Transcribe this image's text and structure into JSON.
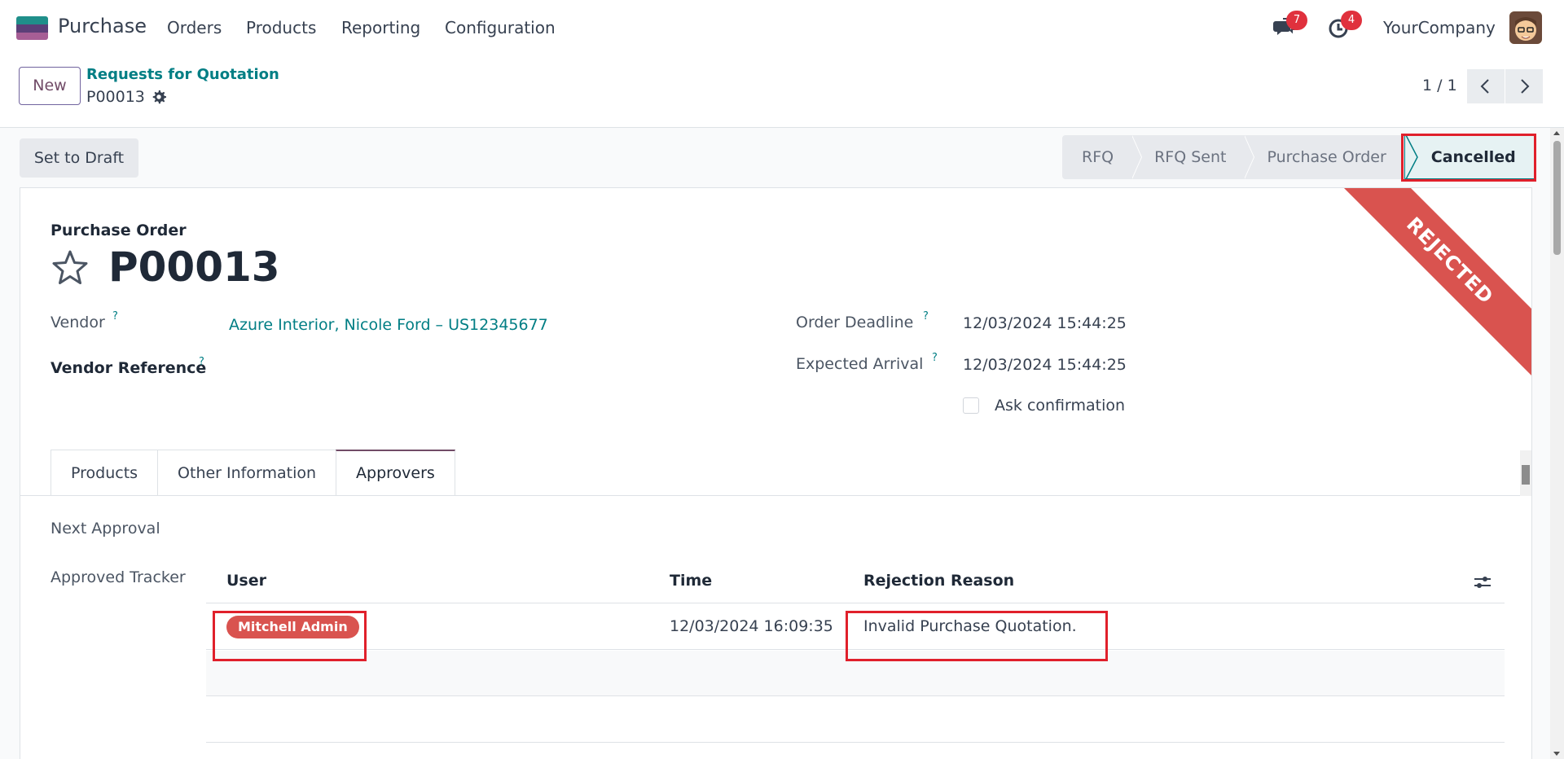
{
  "navbar": {
    "app_name": "Purchase",
    "menu": [
      "Orders",
      "Products",
      "Reporting",
      "Configuration"
    ],
    "messages_count": "7",
    "activities_count": "4",
    "company": "YourCompany"
  },
  "control": {
    "new_label": "New",
    "breadcrumb_parent": "Requests for Quotation",
    "breadcrumb_current": "P00013",
    "pager": "1 / 1"
  },
  "statusbar": {
    "set_to_draft": "Set to Draft",
    "stages": [
      "RFQ",
      "RFQ Sent",
      "Purchase Order",
      "Cancelled"
    ],
    "active_stage": "Cancelled"
  },
  "form": {
    "ribbon": "REJECTED",
    "doc_type": "Purchase Order",
    "doc_name": "P00013",
    "vendor_label": "Vendor",
    "vendor_value": "Azure Interior, Nicole Ford – US12345677",
    "vendor_ref_label": "Vendor Reference",
    "order_deadline_label": "Order Deadline",
    "order_deadline_value": "12/03/2024 15:44:25",
    "expected_arrival_label": "Expected Arrival",
    "expected_arrival_value": "12/03/2024 15:44:25",
    "ask_confirmation_label": "Ask confirmation",
    "help_mark": "?"
  },
  "tabs": [
    "Products",
    "Other Information",
    "Approvers"
  ],
  "active_tab": "Approvers",
  "approvers": {
    "next_approval_label": "Next Approval",
    "approved_tracker_label": "Approved Tracker",
    "columns": [
      "User",
      "Time",
      "Rejection Reason"
    ],
    "rows": [
      {
        "user": "Mitchell Admin",
        "time": "12/03/2024 16:09:35",
        "reason": "Invalid Purchase Quotation."
      }
    ]
  },
  "colors": {
    "brand": "#714b67",
    "link": "#017e84",
    "rejected": "#d9534f",
    "highlight": "#e0202b"
  },
  "icons": [
    "chat-icon",
    "clock-icon",
    "gear-icon",
    "star-icon",
    "chevron-left-icon",
    "chevron-right-icon",
    "column-settings-icon"
  ]
}
